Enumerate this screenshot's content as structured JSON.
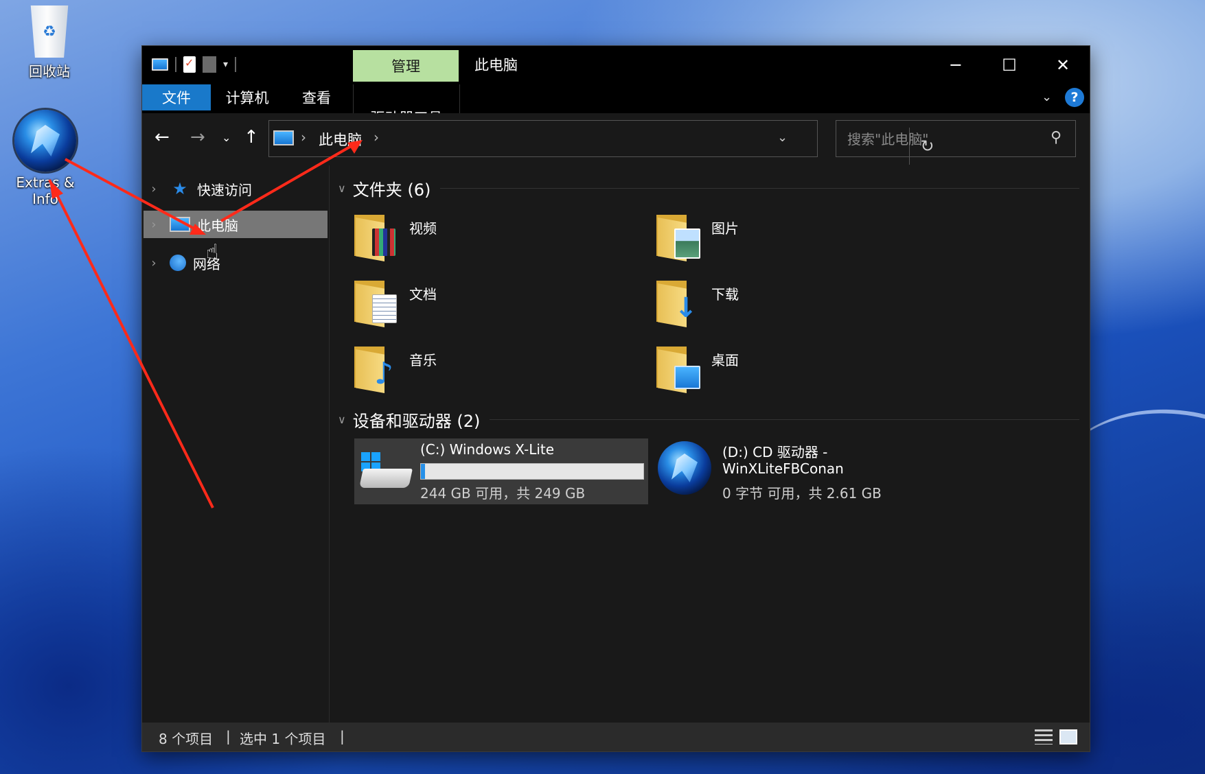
{
  "desktop": {
    "recycle_bin_label": "回收站",
    "extras_label": "Extras & Info"
  },
  "window": {
    "title": "此电脑",
    "context_tab": "管理",
    "controls": {
      "minimize": "─",
      "maximize": "☐",
      "close": "✕"
    }
  },
  "ribbon": {
    "tabs": [
      "文件",
      "计算机",
      "查看",
      "驱动器工具"
    ],
    "help": "?"
  },
  "navbar": {
    "back": "←",
    "forward": "→",
    "recent": "⌄",
    "up": "↑",
    "breadcrumb": "此电脑",
    "refresh": "↻",
    "search_placeholder": "搜索\"此电脑\""
  },
  "navpane": {
    "items": [
      {
        "label": "快速访问",
        "icon": "star-icon"
      },
      {
        "label": "此电脑",
        "icon": "pc-icon",
        "selected": true
      },
      {
        "label": "网络",
        "icon": "network-icon"
      }
    ]
  },
  "content": {
    "folders_header": "文件夹 (6)",
    "folders": [
      "视频",
      "图片",
      "文档",
      "下载",
      "音乐",
      "桌面"
    ],
    "devices_header": "设备和驱动器 (2)",
    "drives": [
      {
        "name": "(C:) Windows X-Lite",
        "free_text": "244 GB 可用，共 249 GB",
        "used_fraction": 0.02
      },
      {
        "name_line1": "(D:) CD 驱动器 -",
        "name_line2": "WinXLiteFBConan",
        "free_text": "0 字节 可用，共 2.61 GB"
      }
    ]
  },
  "status": {
    "count": "8 个项目",
    "separator": "|",
    "selected": "选中 1 个项目"
  },
  "colors": {
    "accent": "#1979ca",
    "context_tab_bg": "#b7e0a0",
    "annotation_arrow": "#ff2a1a"
  }
}
